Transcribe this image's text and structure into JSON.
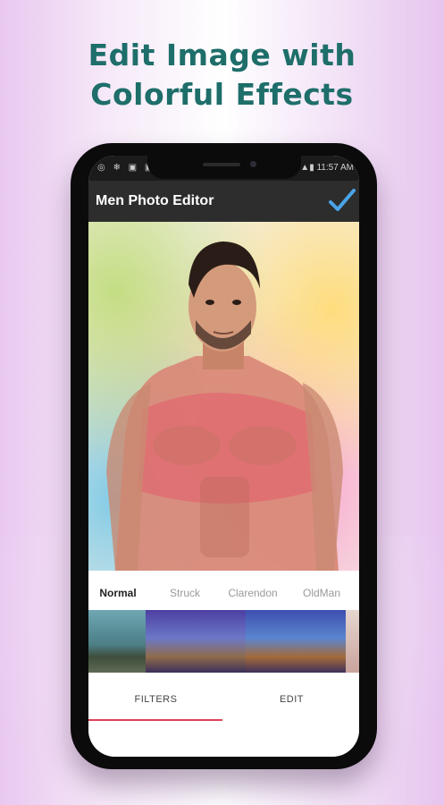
{
  "headline": {
    "line1": "Edit Image with",
    "line2": "Colorful Effects"
  },
  "status_bar": {
    "left": "◎ ❄ ▣ ▣",
    "center": "",
    "time": "11:57 AM"
  },
  "app": {
    "title": "Men Photo Editor",
    "confirm_icon": "checkmark-icon",
    "accent_color": "#e0405a"
  },
  "filters": {
    "items": [
      {
        "label": "Normal",
        "selected": true
      },
      {
        "label": "Struck",
        "selected": false
      },
      {
        "label": "Clarendon",
        "selected": false
      },
      {
        "label": "OldMan",
        "selected": false
      }
    ]
  },
  "tabs": [
    {
      "label": "FILTERS",
      "selected": true
    },
    {
      "label": "EDIT",
      "selected": false
    }
  ]
}
